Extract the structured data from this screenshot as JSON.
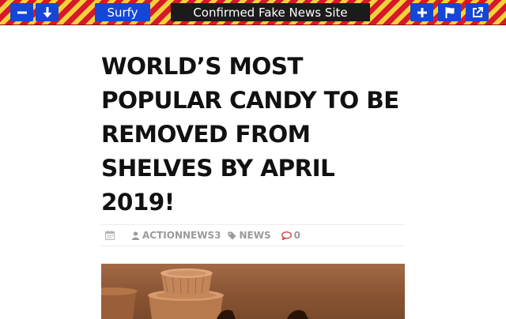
{
  "toolbar": {
    "brand_label": "Surfy",
    "warning_text": "Confirmed Fake News Site",
    "colors": {
      "stripe_red": "#d7182a",
      "stripe_yellow": "#f3d23a",
      "button_blue": "#1546d6",
      "warning_bg": "#1b1b1b"
    },
    "icons": [
      "minus-icon",
      "arrow-down-icon",
      "plus-icon",
      "flag-icon",
      "external-link-icon"
    ]
  },
  "article": {
    "title_lines": [
      "WORLD’S MOST",
      "POPULAR CANDY TO BE",
      "REMOVED FROM",
      "SHELVES BY APRIL",
      "2019!"
    ],
    "meta": {
      "author": "ACTIONNEWS3",
      "category": "NEWS",
      "comments": "0",
      "icons": [
        "calendar-icon",
        "user-icon",
        "tag-icon",
        "comment-icon"
      ]
    },
    "hero_image": {
      "subject": "stacked chocolate peanut butter cups",
      "colors": {
        "bg": "#8a5433",
        "cup": "#c78a5e"
      }
    }
  }
}
